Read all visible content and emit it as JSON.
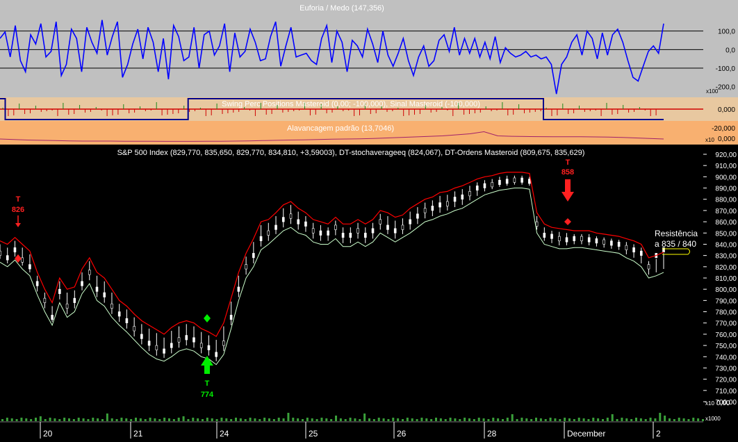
{
  "colors": {
    "osc_bg": "#c0c0c0",
    "swing_bg": "#e8c8a0",
    "lev_bg": "#f8b070",
    "price_bg": "#000000",
    "osc_line": "#0000ff",
    "swing_line": "#00008b",
    "price_red": "#ff0000",
    "price_green": "#ccffcc",
    "volume": "#3aa03a",
    "buy_marker": "#00ee00",
    "sell_marker": "#ff2020",
    "axis_text_dark": "#000000",
    "axis_text_light": "#ffffff"
  },
  "chart_data": [
    {
      "type": "line",
      "title": "Euforia / Medo (147,356)",
      "ylim": [
        -250,
        200
      ],
      "y_ticks": [
        "100,0",
        "0,0",
        "-100,0",
        "-200,0"
      ],
      "y_tick_values": [
        100,
        0,
        -100,
        -200
      ],
      "y_unit_badge": "x100",
      "reference_lines": [
        100,
        0,
        -100
      ],
      "series": [
        {
          "values": [
            60,
            95,
            -40,
            130,
            -60,
            -120,
            80,
            30,
            140,
            -40,
            -10,
            150,
            -140,
            -80,
            110,
            60,
            -120,
            120,
            40,
            -20,
            160,
            -30,
            70,
            150,
            -150,
            -80,
            30,
            110,
            -50,
            120,
            40,
            -120,
            60,
            -160,
            130,
            70,
            -60,
            -40,
            120,
            -100,
            80,
            100,
            -30,
            20,
            140,
            -120,
            90,
            -40,
            -10,
            110,
            40,
            -60,
            -50,
            70,
            150,
            -90,
            20,
            120,
            -40,
            -30,
            -20,
            -60,
            -80,
            60,
            130,
            -70,
            100,
            40,
            -120,
            50,
            20,
            -40,
            110,
            30,
            -70,
            100,
            -30,
            -90,
            -20,
            60,
            -60,
            -140,
            -40,
            20,
            -90,
            -60,
            50,
            80,
            -10,
            120,
            -30,
            60,
            -20,
            60,
            -40,
            40,
            -50,
            70,
            -70,
            10,
            -20,
            -40,
            -30,
            -10,
            -40,
            -30,
            -50,
            -40,
            -80,
            -240,
            -80,
            -40,
            40,
            80,
            -30,
            100,
            60,
            -50,
            90,
            -30,
            80,
            110,
            40,
            -60,
            -150,
            -170,
            -90,
            -10,
            20,
            -20,
            140
          ]
        }
      ]
    },
    {
      "type": "line",
      "title": "Swing Perc Positions Masteroid (0,00; -100,000), Sinal Masteroid (-100,000)",
      "ylim": [
        -100,
        0
      ],
      "y_ticks": [
        "0,000"
      ],
      "y_tick_values": [
        0
      ],
      "series": [
        {
          "values": [
            0,
            -100,
            -100,
            -100,
            -100,
            -100,
            -100,
            -100,
            -100,
            -100,
            -100,
            -100,
            -100,
            -100,
            -100,
            -100,
            -100,
            -100,
            -100,
            -100,
            -100,
            -100,
            -100,
            -100,
            -100,
            -100,
            -100,
            -100,
            -100,
            -100,
            -100,
            -100,
            -100,
            -100,
            -100,
            -100,
            0,
            0,
            0,
            0,
            0,
            0,
            0,
            0,
            0,
            0,
            0,
            0,
            0,
            0,
            0,
            0,
            0,
            0,
            0,
            0,
            0,
            0,
            0,
            0,
            0,
            0,
            0,
            0,
            0,
            0,
            0,
            0,
            0,
            0,
            0,
            0,
            0,
            0,
            0,
            0,
            0,
            0,
            0,
            0,
            0,
            0,
            0,
            0,
            0,
            0,
            0,
            0,
            0,
            0,
            0,
            0,
            0,
            0,
            0,
            0,
            0,
            0,
            0,
            0,
            0,
            0,
            0,
            0,
            -100,
            -100,
            -100,
            -100,
            -100,
            -100,
            -100,
            -100,
            -100,
            -100,
            -100,
            -100,
            -100,
            -100,
            -100,
            -100,
            -100,
            -100,
            -100,
            -100,
            -100,
            -100,
            -100,
            -100
          ]
        }
      ]
    },
    {
      "type": "line",
      "title": "Alavancagem padrão (13,7046)",
      "ylim": [
        -25,
        -5
      ],
      "y_ticks": [
        "-20,000",
        "0,000"
      ],
      "y_tick_values": [
        -20,
        0
      ],
      "y_unit_badge": "x10",
      "series": [
        {
          "values": [
            -21,
            -21.5,
            -22,
            -22.3,
            -22.5,
            -22.8,
            -23,
            -23,
            -23,
            -23.1,
            -23.2,
            -23.2,
            -23.3,
            -23.3,
            -23.3,
            -23.2,
            -23.2,
            -23,
            -22.8,
            -22.5,
            -22.3,
            -22,
            -21.8,
            -21.5,
            -21.2,
            -21,
            -20.8,
            -20.5,
            -20,
            -19.5,
            -19,
            -18.5,
            -18,
            -17,
            -16,
            -14,
            -18,
            -18.4,
            -18.6,
            -18.7,
            -18.8,
            -18.8,
            -18.9,
            -19,
            -19.2,
            -19.5,
            -20,
            -20.5,
            -21
          ]
        }
      ]
    },
    {
      "type": "line",
      "title": "S&P 500 Index (829,770, 835,650, 829,770, 834,810, +3,59003), DT-stochaverageeq (824,067), DT-Ordens Masteroid (809,675, 835,629)",
      "ylim": [
        690,
        925
      ],
      "y_ticks": [
        "920,00",
        "910,00",
        "900,00",
        "890,00",
        "880,00",
        "870,00",
        "860,00",
        "850,00",
        "840,00",
        "830,00",
        "820,00",
        "810,00",
        "800,00",
        "790,00",
        "780,00",
        "770,00",
        "760,00",
        "750,00",
        "740,00",
        "730,00",
        "720,00",
        "710,00",
        "700,00"
      ],
      "y_tick_values": [
        920,
        910,
        900,
        890,
        880,
        870,
        860,
        850,
        840,
        830,
        820,
        810,
        800,
        790,
        780,
        770,
        760,
        750,
        740,
        730,
        720,
        710,
        700
      ],
      "x_ticks": [
        "20",
        "21",
        "24",
        "25",
        "26",
        "28",
        "December",
        "2"
      ],
      "series": [
        {
          "values": [
            832,
            828,
            835,
            826,
            820,
            805,
            790,
            775,
            798,
            785,
            790,
            805,
            815,
            800,
            795,
            785,
            778,
            772,
            765,
            758,
            752,
            748,
            745,
            750,
            755,
            757,
            755,
            750,
            748,
            742,
            752,
            775,
            800,
            820,
            830,
            845,
            850,
            855,
            862,
            865,
            860,
            858,
            852,
            850,
            850,
            855,
            848,
            848,
            852,
            848,
            852,
            860,
            855,
            852,
            855,
            860,
            865,
            870,
            872,
            875,
            876,
            880,
            882,
            885,
            890,
            892,
            893,
            895,
            896,
            897,
            897,
            896,
            858,
            848,
            847,
            845,
            844,
            845,
            845,
            844,
            843,
            842,
            841,
            840,
            837,
            835,
            832,
            820,
            830,
            835
          ]
        },
        {
          "values": [
            843,
            840,
            846,
            840,
            834,
            815,
            800,
            788,
            810,
            800,
            802,
            818,
            828,
            815,
            810,
            800,
            790,
            785,
            778,
            772,
            768,
            764,
            760,
            766,
            770,
            772,
            770,
            765,
            762,
            758,
            770,
            792,
            815,
            832,
            845,
            860,
            862,
            868,
            875,
            878,
            872,
            868,
            862,
            860,
            858,
            864,
            858,
            858,
            862,
            858,
            862,
            870,
            868,
            864,
            866,
            872,
            876,
            880,
            882,
            886,
            887,
            890,
            892,
            895,
            898,
            900,
            901,
            903,
            904,
            904,
            904,
            903,
            868,
            858,
            855,
            854,
            853,
            852,
            852,
            852,
            850,
            849,
            848,
            847,
            845,
            843,
            840,
            828,
            830,
            833
          ]
        },
        {
          "values": [
            824,
            820,
            826,
            818,
            812,
            795,
            780,
            768,
            788,
            775,
            780,
            796,
            805,
            790,
            785,
            775,
            768,
            762,
            755,
            748,
            742,
            738,
            736,
            740,
            745,
            747,
            745,
            740,
            738,
            733,
            742,
            765,
            790,
            810,
            820,
            835,
            840,
            846,
            852,
            855,
            850,
            848,
            842,
            840,
            840,
            845,
            838,
            838,
            842,
            838,
            842,
            850,
            846,
            842,
            846,
            850,
            855,
            860,
            862,
            865,
            867,
            870,
            872,
            876,
            880,
            884,
            886,
            888,
            889,
            890,
            890,
            889,
            850,
            840,
            838,
            836,
            836,
            837,
            837,
            836,
            835,
            834,
            833,
            832,
            828,
            825,
            820,
            810,
            812,
            815
          ]
        }
      ],
      "annotations": [
        {
          "text": "T",
          "value_text": "826",
          "kind": "sell"
        },
        {
          "text": "T",
          "value_text": "774",
          "kind": "buy"
        },
        {
          "text": "T",
          "value_text": "858",
          "kind": "sell"
        },
        {
          "text": "Resistência",
          "text2": "a 835 / 840",
          "kind": "note"
        }
      ]
    },
    {
      "type": "bar",
      "title": "",
      "y_ticks": [
        "0,00"
      ],
      "y_unit_badge_top": "x10",
      "y_unit_badge_bottom": "x1000",
      "values": [
        1,
        1,
        1,
        1,
        1,
        1,
        1,
        1,
        2,
        1,
        1,
        1,
        1,
        1,
        1,
        1,
        1,
        1,
        1,
        1,
        1,
        1,
        3,
        1,
        1,
        1,
        1,
        1,
        1,
        1,
        1,
        1,
        1,
        1,
        1,
        1,
        1,
        1,
        2,
        1,
        1,
        1,
        1,
        1,
        1,
        1,
        1,
        1,
        1,
        1,
        1,
        1,
        1,
        1,
        1,
        1,
        1,
        1,
        1,
        1,
        4,
        1,
        1,
        1,
        1,
        1,
        1,
        1,
        1,
        1,
        2,
        1,
        1,
        1,
        1,
        1,
        3,
        1,
        1,
        1,
        1,
        1,
        1,
        1,
        1,
        1,
        1,
        1,
        1,
        1,
        1,
        1,
        1,
        1,
        1,
        1,
        1,
        1,
        1,
        1,
        1,
        1,
        1,
        1,
        1,
        1,
        1,
        3,
        1,
        1,
        1,
        1,
        1,
        1,
        1,
        1,
        1,
        1,
        1,
        1,
        1,
        1,
        1,
        1,
        1,
        1,
        1,
        1,
        3,
        1,
        1,
        1,
        1,
        1,
        1,
        1,
        1,
        1,
        4,
        2,
        1,
        1,
        1,
        1,
        1,
        1,
        1,
        1
      ]
    }
  ]
}
